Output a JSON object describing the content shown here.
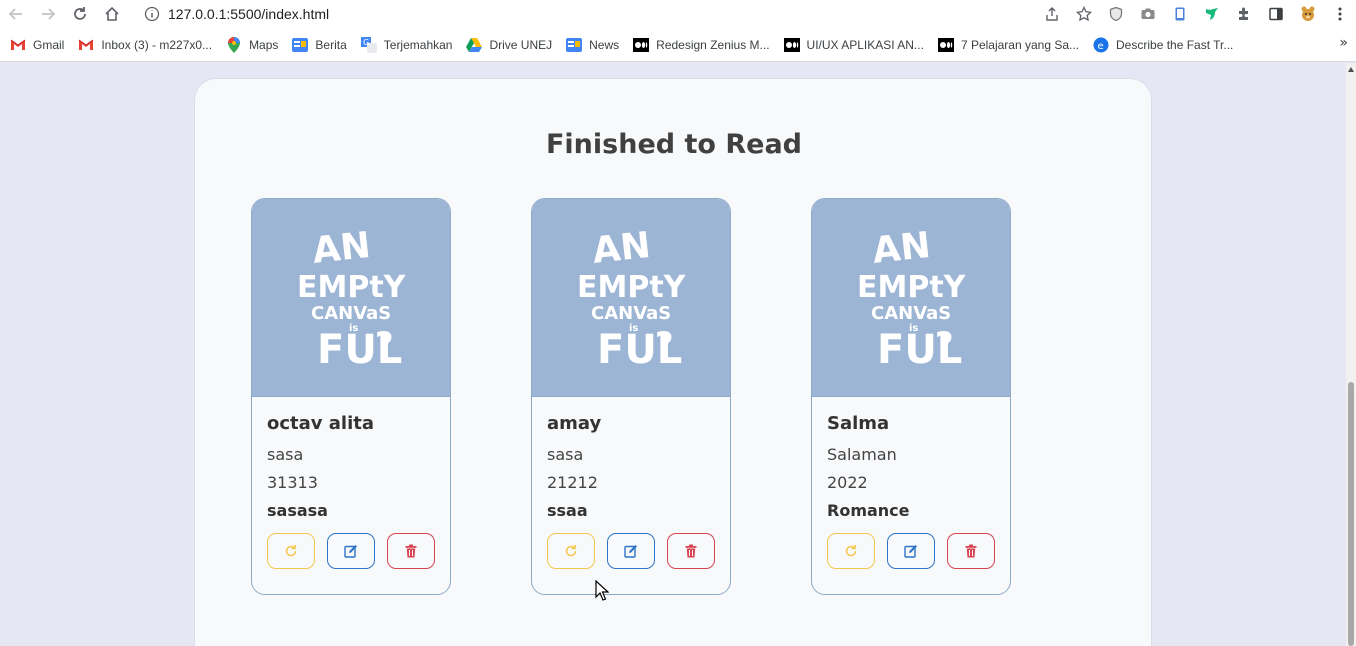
{
  "browser": {
    "url": "127.0.0.1:5500/index.html",
    "bookmarks": [
      {
        "label": "Gmail",
        "icon": "gmail-icon"
      },
      {
        "label": "Inbox (3) - m227x0...",
        "icon": "gmail-icon"
      },
      {
        "label": "Maps",
        "icon": "maps-icon"
      },
      {
        "label": "Berita",
        "icon": "news-icon"
      },
      {
        "label": "Terjemahkan",
        "icon": "translate-icon"
      },
      {
        "label": "Drive UNEJ",
        "icon": "drive-icon"
      },
      {
        "label": "News",
        "icon": "news-icon"
      },
      {
        "label": "Redesign Zenius M...",
        "icon": "medium-icon"
      },
      {
        "label": "UI/UX APLIKASI AN...",
        "icon": "medium-icon"
      },
      {
        "label": "7 Pelajaran yang Sa...",
        "icon": "medium-icon"
      },
      {
        "label": "Describe the Fast Tr...",
        "icon": "edge-icon"
      }
    ],
    "more_label": "»"
  },
  "page": {
    "title": "Finished to Read"
  },
  "books": [
    {
      "name": "octav alita",
      "author": "sasa",
      "year": "31313",
      "genre": "sasasa"
    },
    {
      "name": "amay",
      "author": "sasa",
      "year": "21212",
      "genre": "ssaa"
    },
    {
      "name": "Salma",
      "author": "Salaman",
      "year": "2022",
      "genre": "Romance"
    }
  ],
  "colors": {
    "page_bg": "#e6e6f5",
    "cover_bg": "#9db5d4",
    "undo": "#f3c84f",
    "edit": "#2b74c9",
    "delete": "#d94452"
  },
  "icons": {
    "undo": "rotate-cw-icon",
    "edit": "edit-icon",
    "delete": "trash-icon"
  },
  "cover_art": "An Empty Canvas is Full?"
}
